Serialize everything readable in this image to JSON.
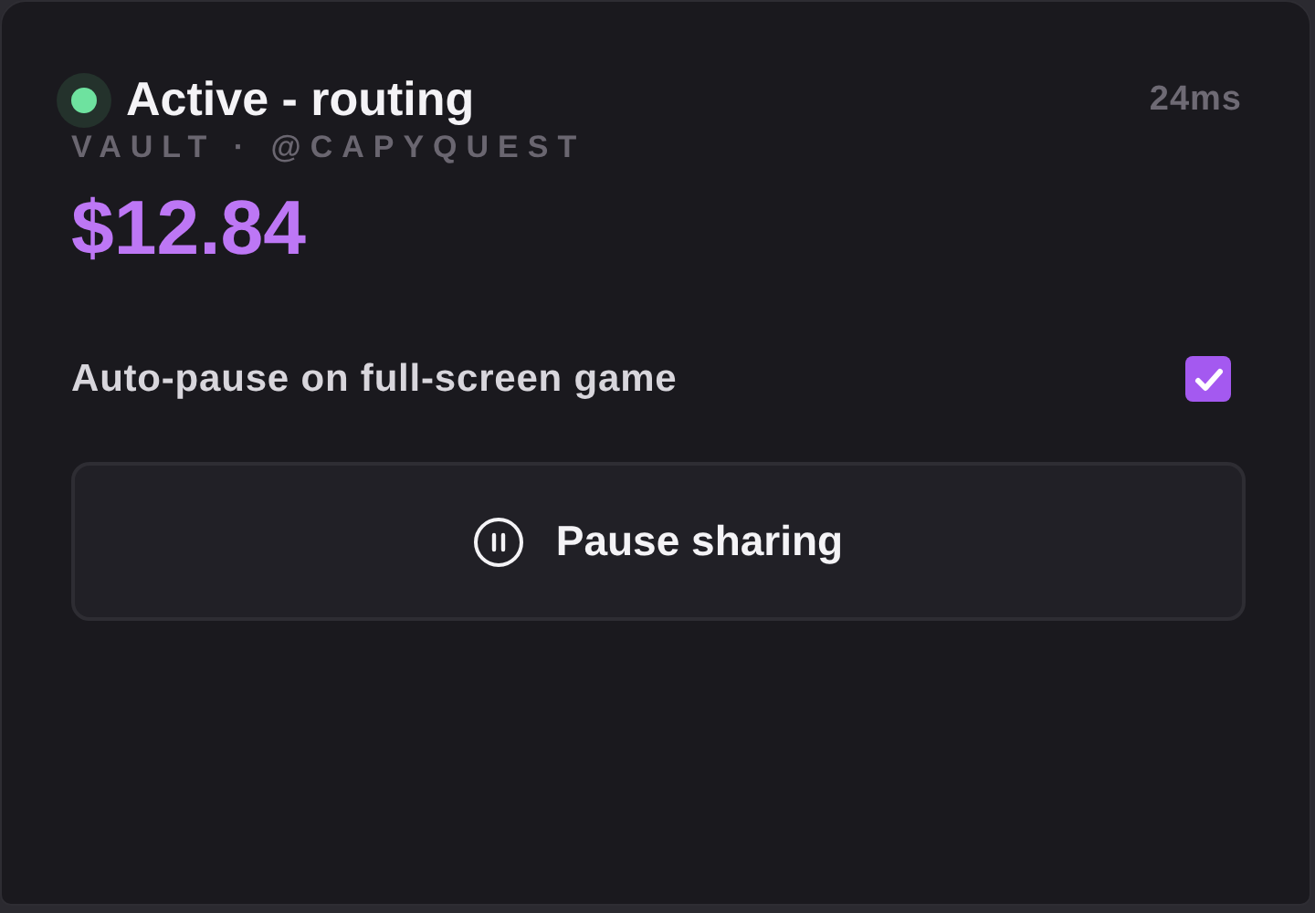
{
  "status": {
    "label": "Active - routing",
    "active": true
  },
  "latency": "24ms",
  "account": "VAULT · @CAPYQUEST",
  "balance": "$12.84",
  "auto_pause": {
    "label": "Auto-pause on full-screen game",
    "checked": true
  },
  "action": {
    "label": "Pause sharing"
  }
}
